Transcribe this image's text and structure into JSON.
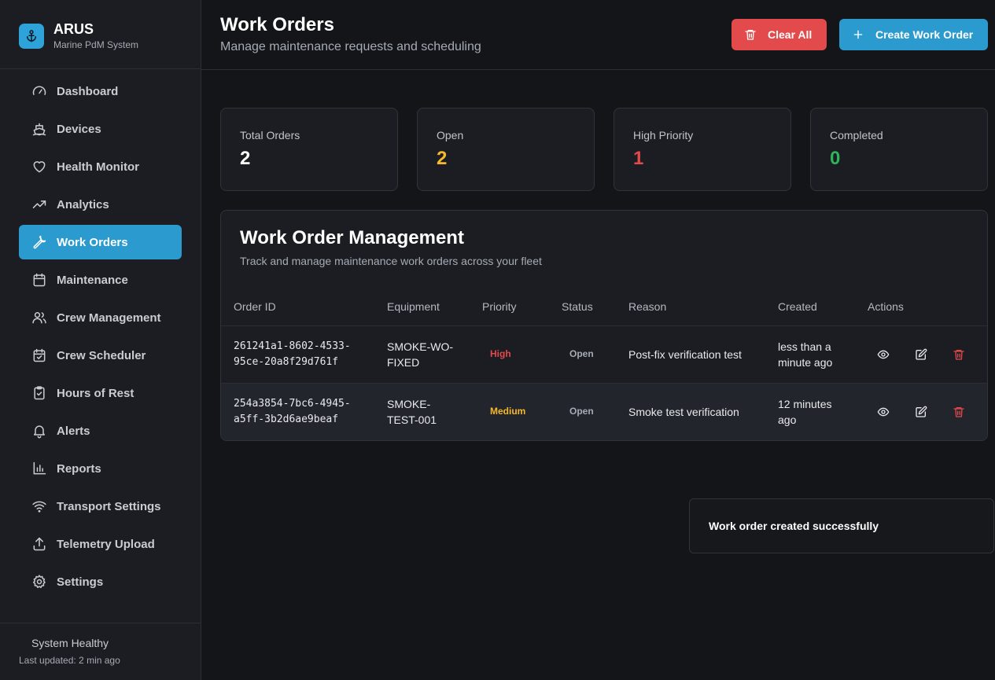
{
  "brand": {
    "title": "ARUS",
    "subtitle": "Marine PdM System",
    "icon": "anchor-icon"
  },
  "sidebar": {
    "items": [
      {
        "label": "Dashboard",
        "icon": "gauge-icon",
        "active": false
      },
      {
        "label": "Devices",
        "icon": "ship-icon",
        "active": false
      },
      {
        "label": "Health Monitor",
        "icon": "heart-icon",
        "active": false
      },
      {
        "label": "Analytics",
        "icon": "trending-up-icon",
        "active": false
      },
      {
        "label": "Work Orders",
        "icon": "wrench-icon",
        "active": true
      },
      {
        "label": "Maintenance",
        "icon": "calendar-icon",
        "active": false
      },
      {
        "label": "Crew Management",
        "icon": "users-icon",
        "active": false
      },
      {
        "label": "Crew Scheduler",
        "icon": "calendar-check-icon",
        "active": false
      },
      {
        "label": "Hours of Rest",
        "icon": "clipboard-check-icon",
        "active": false
      },
      {
        "label": "Alerts",
        "icon": "bell-icon",
        "active": false
      },
      {
        "label": "Reports",
        "icon": "bar-chart-icon",
        "active": false
      },
      {
        "label": "Transport Settings",
        "icon": "wifi-icon",
        "active": false
      },
      {
        "label": "Telemetry Upload",
        "icon": "upload-icon",
        "active": false
      },
      {
        "label": "Settings",
        "icon": "gear-icon",
        "active": false
      }
    ],
    "footer": {
      "status": "System Healthy",
      "updated": "Last updated: 2 min ago"
    }
  },
  "header": {
    "title": "Work Orders",
    "subtitle": "Manage maintenance requests and scheduling",
    "clear_label": "Clear All",
    "create_label": "Create Work Order"
  },
  "stats": [
    {
      "label": "Total Orders",
      "value": "2",
      "color": "#ffffff"
    },
    {
      "label": "Open",
      "value": "2",
      "color": "#f5b82e"
    },
    {
      "label": "High Priority",
      "value": "1",
      "color": "#e24a4c"
    },
    {
      "label": "Completed",
      "value": "0",
      "color": "#2fb35a"
    }
  ],
  "panel": {
    "title": "Work Order Management",
    "subtitle": "Track and manage maintenance work orders across your fleet",
    "columns": [
      "Order ID",
      "Equipment",
      "Priority",
      "Status",
      "Reason",
      "Created",
      "Actions"
    ],
    "rows": [
      {
        "id_line1": "261241a1-8602-4533-",
        "id_line2": "95ce-20a8f29d761f",
        "equip_line1": "SMOKE-WO-",
        "equip_line2": "FIXED",
        "priority": "High",
        "priority_color": "#e24a4c",
        "status": "Open",
        "reason": "Post-fix verification test",
        "created_line1": "less than a",
        "created_line2": "minute ago"
      },
      {
        "id_line1": "254a3854-7bc6-4945-",
        "id_line2": "a5ff-3b2d6ae9beaf",
        "equip_line1": "SMOKE-",
        "equip_line2": "TEST-001",
        "priority": "Medium",
        "priority_color": "#f5b82e",
        "status": "Open",
        "reason": "Smoke test verification",
        "created_line1": "12 minutes",
        "created_line2": "ago"
      }
    ]
  },
  "toast": {
    "message": "Work order created successfully"
  },
  "colors": {
    "accent": "#2b9bcf",
    "danger": "#e24a4c",
    "warning": "#f5b82e",
    "success": "#2fb35a"
  }
}
